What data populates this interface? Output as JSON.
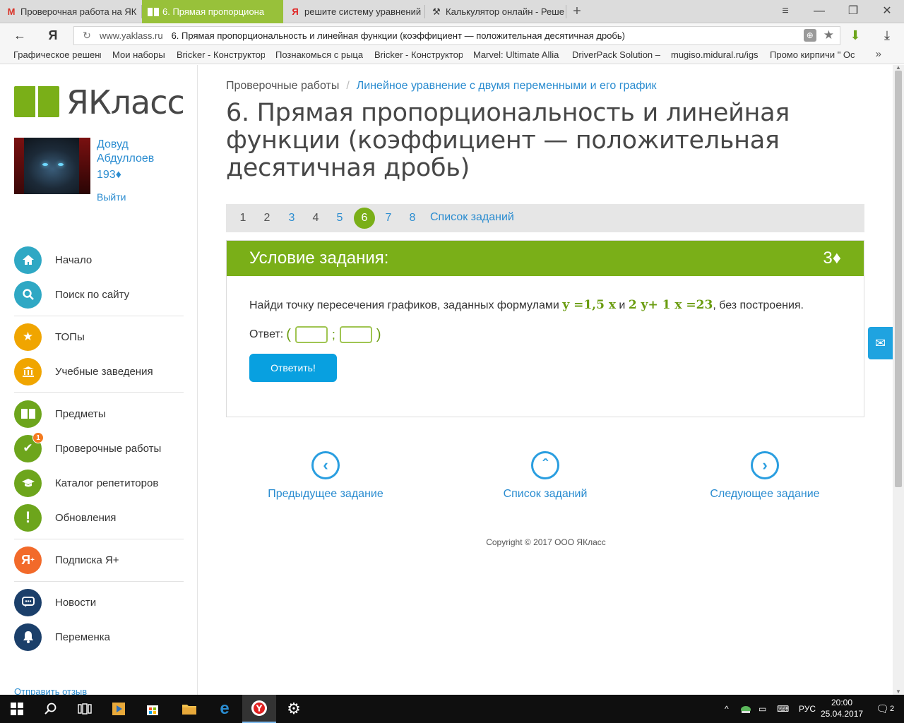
{
  "browser": {
    "tabs": [
      {
        "title": "Проверочная работа на ЯК",
        "favicon": "gmail-icon",
        "active": false
      },
      {
        "title": "6. Прямая пропорциона",
        "favicon": "yaklass-icon",
        "active": true
      },
      {
        "title": "решите систему уравнений",
        "favicon": "yandex-icon",
        "active": false
      },
      {
        "title": "Калькулятор онлайн - Реше",
        "favicon": "calculator-icon",
        "active": false
      }
    ],
    "address": {
      "domain": "www.yaklass.ru",
      "page_title": "6. Прямая пропорциональность и линейная функции (коэффициент — положительная десятичная дробь)"
    },
    "bookmarks": [
      "Графическое решени",
      "Мои наборы",
      "Bricker - Конструктор",
      "Познакомься с рыца",
      "Bricker - Конструктор",
      "Marvel: Ultimate Allia",
      "DriverPack Solution –",
      "mugiso.midural.ru/igs",
      "Промо кирпичи \" Ос"
    ]
  },
  "sidebar": {
    "logo_text": "ЯКласс",
    "user": {
      "name": "Довуд Абдуллоев",
      "points": "193♦",
      "logout": "Выйти"
    },
    "menu": [
      {
        "label": "Начало",
        "icon": "home-icon",
        "color": "#2fa8c4"
      },
      {
        "label": "Поиск по сайту",
        "icon": "search-icon",
        "color": "#2fa8c4"
      },
      {
        "label": "ТОПы",
        "icon": "star-icon",
        "color": "#f0a500"
      },
      {
        "label": "Учебные заведения",
        "icon": "institution-icon",
        "color": "#f0a500"
      },
      {
        "label": "Предметы",
        "icon": "book-icon",
        "color": "#6da51c"
      },
      {
        "label": "Проверочные работы",
        "icon": "check-icon",
        "color": "#6da51c",
        "badge": "1"
      },
      {
        "label": "Каталог репетиторов",
        "icon": "graduation-cap-icon",
        "color": "#6da51c"
      },
      {
        "label": "Обновления",
        "icon": "exclamation-icon",
        "color": "#6da51c"
      },
      {
        "label": "Подписка Я+",
        "icon": "ya-plus-icon",
        "color": "#f26a2a"
      },
      {
        "label": "Новости",
        "icon": "chat-icon",
        "color": "#1b3f6a"
      },
      {
        "label": "Переменка",
        "icon": "bell-icon",
        "color": "#1b3f6a"
      }
    ],
    "feedback": "Отправить отзыв"
  },
  "main": {
    "breadcrumb": {
      "root": "Проверочные работы",
      "separator": "/",
      "current": "Линейное уравнение с двумя переменными и его график"
    },
    "title": "6. Прямая пропорциональность и линейная функции (коэффициент — положительная десятичная дробь)",
    "pager": {
      "pages": [
        "1",
        "2",
        "3",
        "4",
        "5",
        "6",
        "7",
        "8"
      ],
      "current": "6",
      "list_label": "Список заданий"
    },
    "task": {
      "header": "Условие задания:",
      "points": "3♦",
      "question_before": "Найди точку пересечения графиков, заданных формулами ",
      "formula1": "y =1,5 x",
      "question_and": " и ",
      "formula2": "2 y+ 1 x =23",
      "question_after": ", без построения.",
      "answer_label": "Ответ:",
      "open_paren": "(",
      "semicolon": ";",
      "close_paren": ")",
      "answer_x": "",
      "answer_y": "",
      "submit_label": "Ответить!"
    },
    "nav": {
      "prev": "Предыдущее задание",
      "list": "Список заданий",
      "next": "Следующее задание"
    },
    "copyright": "Copyright © 2017 ООО ЯКласс"
  },
  "taskbar": {
    "language": "РУС",
    "time": "20:00",
    "date": "25.04.2017",
    "notifications": "2"
  }
}
